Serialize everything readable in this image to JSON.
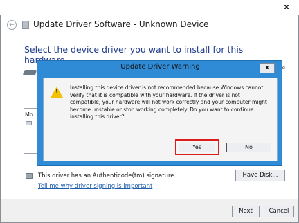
{
  "window": {
    "close_glyph": "x",
    "back_glyph": "←",
    "title": "Update Driver Software - Unknown Device",
    "heading": "Select the device driver you want to install for this hardware.",
    "partial_text": "ve a",
    "models_label": "Mo",
    "signature_text": "This driver has an Authenticode(tm) signature.",
    "signing_link": "Tell me why driver signing is important",
    "have_disk_label": "Have Disk...",
    "next_label": "Next",
    "cancel_label": "Cancel"
  },
  "dialog": {
    "title": "Update Driver Warning",
    "close_glyph": "x",
    "warning_mark": "!",
    "message": "Installing this device driver is not recommended because Windows cannot verify that it is compatible with your hardware. If the driver is not compatible, your hardware will not work correctly and your computer might become unstable or stop working completely. Do you want to continue installing this driver?",
    "yes_label": "Yes",
    "no_label": "No"
  },
  "colors": {
    "dialog_frame": "#2f8bd6",
    "highlight": "#dd1c1c",
    "heading": "#1f3b8a",
    "link": "#1f5fb0",
    "warning_icon": "#f2c200"
  }
}
